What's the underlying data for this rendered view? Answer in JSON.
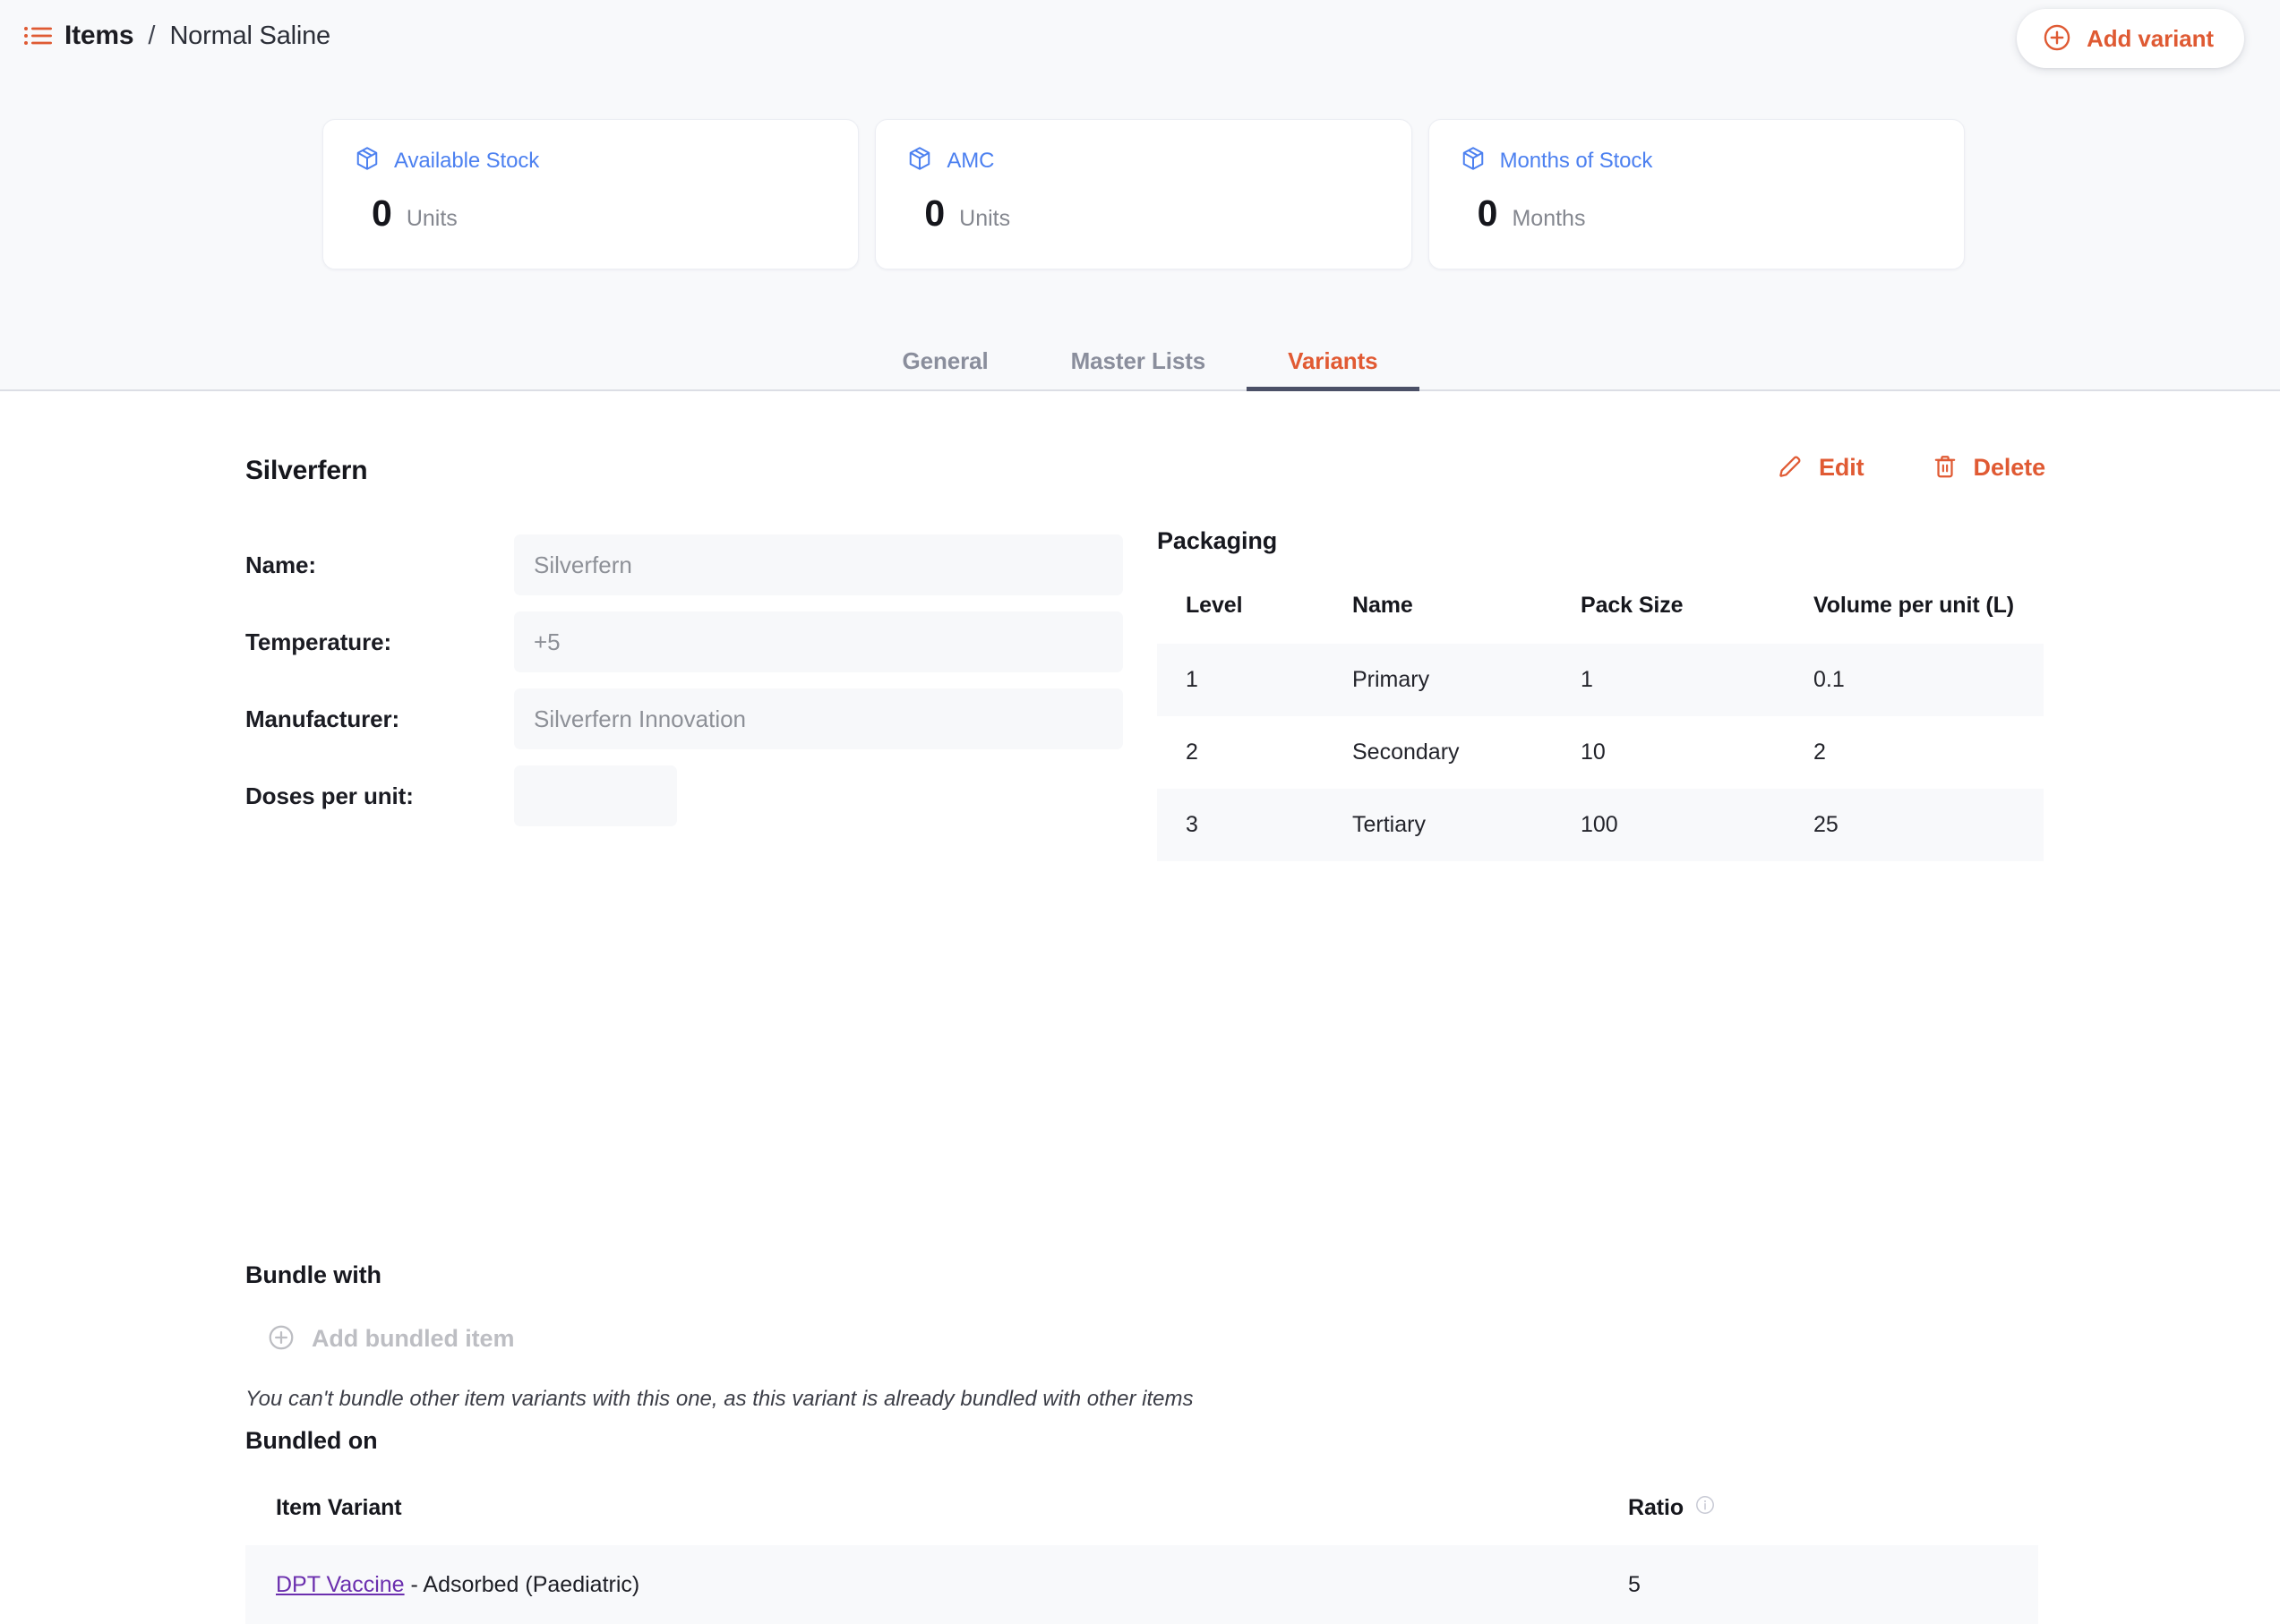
{
  "breadcrumb": {
    "icon": "list-icon",
    "root": "Items",
    "separator": "/",
    "current": "Normal Saline"
  },
  "header": {
    "add_variant_label": "Add variant",
    "add_variant_icon": "plus-circle-icon"
  },
  "stats": [
    {
      "icon": "package-icon",
      "label": "Available Stock",
      "value": "0",
      "unit": "Units"
    },
    {
      "icon": "package-icon",
      "label": "AMC",
      "value": "0",
      "unit": "Units"
    },
    {
      "icon": "package-icon",
      "label": "Months of Stock",
      "value": "0",
      "unit": "Months"
    }
  ],
  "tabs": [
    {
      "label": "General",
      "active": false
    },
    {
      "label": "Master Lists",
      "active": false
    },
    {
      "label": "Variants",
      "active": true
    }
  ],
  "variant": {
    "title": "Silverfern",
    "edit_label": "Edit",
    "delete_label": "Delete",
    "fields": [
      {
        "label": "Name:",
        "value": "Silverfern"
      },
      {
        "label": "Temperature:",
        "value": "+5"
      },
      {
        "label": "Manufacturer:",
        "value": "Silverfern Innovation"
      },
      {
        "label": "Doses per unit:",
        "value": ""
      }
    ]
  },
  "packaging": {
    "title": "Packaging",
    "columns": [
      "Level",
      "Name",
      "Pack Size",
      "Volume per unit (L)"
    ],
    "rows": [
      {
        "level": "1",
        "name": "Primary",
        "pack_size": "1",
        "volume": "0.1"
      },
      {
        "level": "2",
        "name": "Secondary",
        "pack_size": "10",
        "volume": "2"
      },
      {
        "level": "3",
        "name": "Tertiary",
        "pack_size": "100",
        "volume": "25"
      }
    ]
  },
  "bundle_with": {
    "title": "Bundle with",
    "add_label": "Add bundled item",
    "add_icon": "plus-circle-icon",
    "note": "You can't bundle other item variants with this one, as this variant is already bundled with other items"
  },
  "bundled_on": {
    "title": "Bundled on",
    "columns": [
      "Item Variant",
      "Ratio"
    ],
    "ratio_info_icon": "info-icon",
    "rows": [
      {
        "link_text": "DPT Vaccine",
        "suffix": " - Adsorbed (Paediatric)",
        "ratio": "5"
      }
    ]
  },
  "colors": {
    "accent_orange": "#e05a33",
    "accent_blue": "#4c80f0",
    "link_purple": "#6b2fae",
    "tab_underline": "#4b5067",
    "page_bg": "#f8f9fb"
  }
}
